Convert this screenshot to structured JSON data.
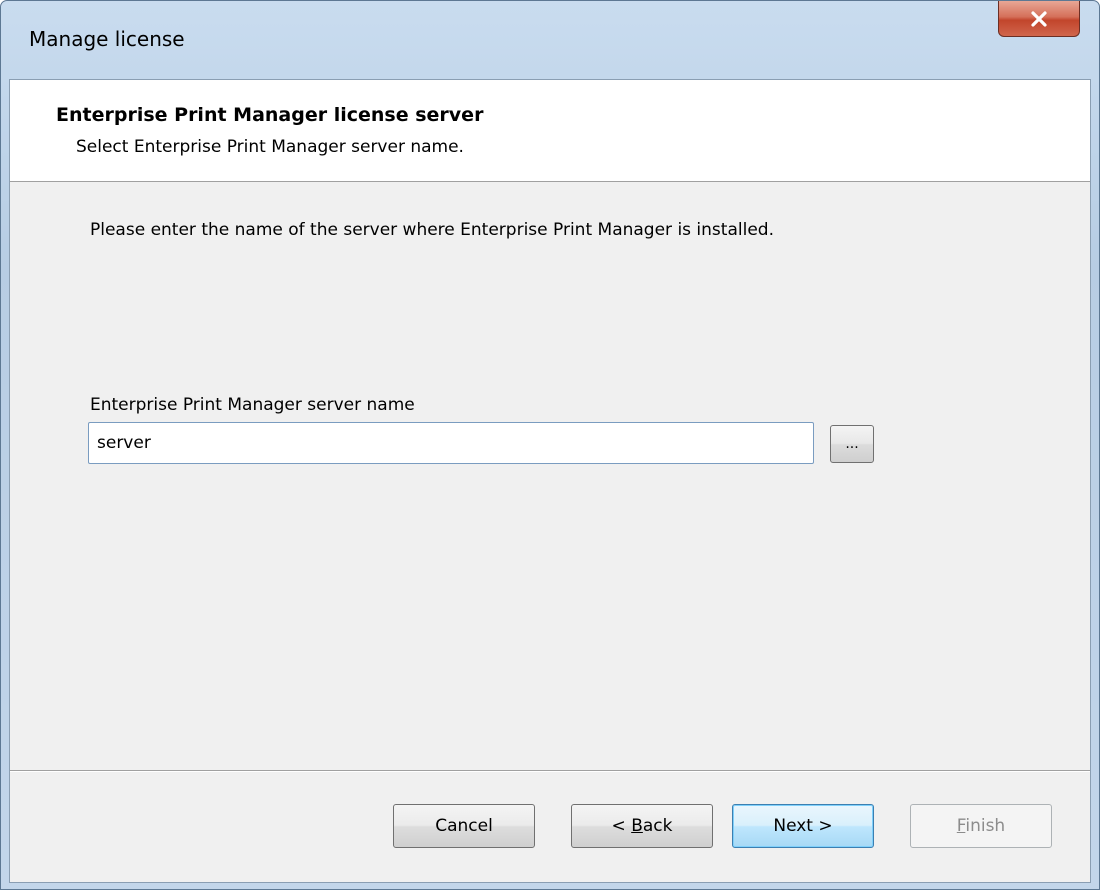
{
  "window": {
    "title": "Manage license",
    "close_symbol": "X"
  },
  "header": {
    "title": "Enterprise Print Manager license server",
    "subtitle": "Select Enterprise Print Manager server name."
  },
  "main": {
    "instruction": "Please enter the name of the server where Enterprise Print Manager is installed.",
    "field_label": "Enterprise Print Manager server name",
    "server_input": {
      "value": "server",
      "placeholder": ""
    },
    "browse_label": "..."
  },
  "footer": {
    "cancel": "Cancel",
    "back": {
      "prefix": "< ",
      "accel": "B",
      "rest": "ack"
    },
    "next": "Next >",
    "finish": {
      "accel": "F",
      "rest": "inish"
    }
  },
  "colors": {
    "close_button": "#c2452c",
    "client_background": "#f0f0f0",
    "header_background": "#ffffff",
    "default_button_border": "#3c7fb1",
    "disabled_text": "#8c8c8c"
  },
  "icons": {
    "close": "close-icon"
  }
}
